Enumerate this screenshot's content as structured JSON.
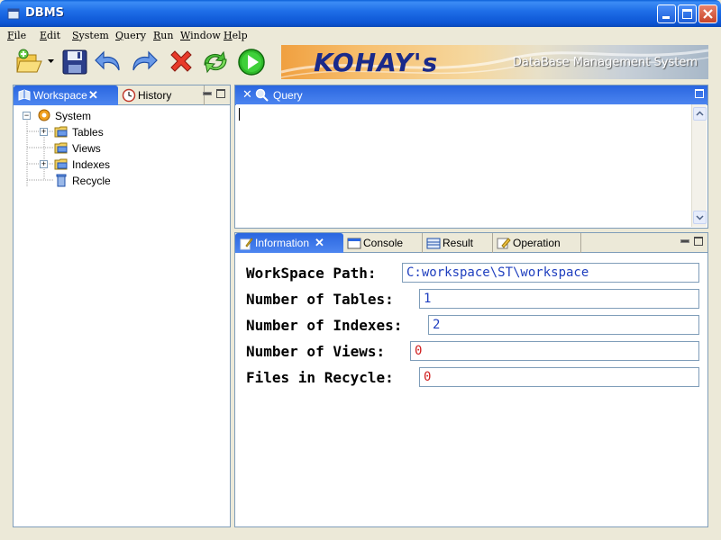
{
  "window": {
    "title": "DBMS"
  },
  "menu": [
    "File",
    "Edit",
    "System",
    "Query",
    "Run",
    "Window",
    "Help"
  ],
  "toolbar": {
    "icons": [
      "open-folder-icon",
      "save-icon",
      "undo-icon",
      "redo-icon",
      "delete-icon",
      "refresh-icon",
      "run-icon"
    ]
  },
  "banner": {
    "logo": "KOHAY's",
    "subtitle": "DataBase Management System"
  },
  "workspace_panel": {
    "tabs": [
      {
        "label": "Workspace",
        "active": true
      },
      {
        "label": "History",
        "active": false
      }
    ],
    "tree": {
      "root": "System",
      "children": [
        {
          "label": "Tables",
          "expandable": true
        },
        {
          "label": "Views",
          "expandable": false
        },
        {
          "label": "Indexes",
          "expandable": true
        },
        {
          "label": "Recycle",
          "expandable": false
        }
      ]
    }
  },
  "query_panel": {
    "tab_label": "Query",
    "content": ""
  },
  "info_panel": {
    "tabs": [
      {
        "label": "Information",
        "active": true
      },
      {
        "label": "Console",
        "active": false
      },
      {
        "label": "Result",
        "active": false
      },
      {
        "label": "Operation",
        "active": false
      }
    ],
    "fields": [
      {
        "label": "WorkSpace Path:",
        "value": "C:workspace\\ST\\workspace",
        "color": "#1f3fbf"
      },
      {
        "label": "Number of Tables:",
        "value": "1",
        "color": "#1f3fbf"
      },
      {
        "label": "Number of Indexes:",
        "value": "2",
        "color": "#1f3fbf"
      },
      {
        "label": "Number of Views:",
        "value": "0",
        "color": "#d02020"
      },
      {
        "label": "Files in Recycle:",
        "value": "0",
        "color": "#d02020"
      }
    ]
  },
  "colors": {
    "active_tab": "#2a66e0",
    "panel_border": "#7f9db9",
    "chrome": "#ece9d8"
  }
}
